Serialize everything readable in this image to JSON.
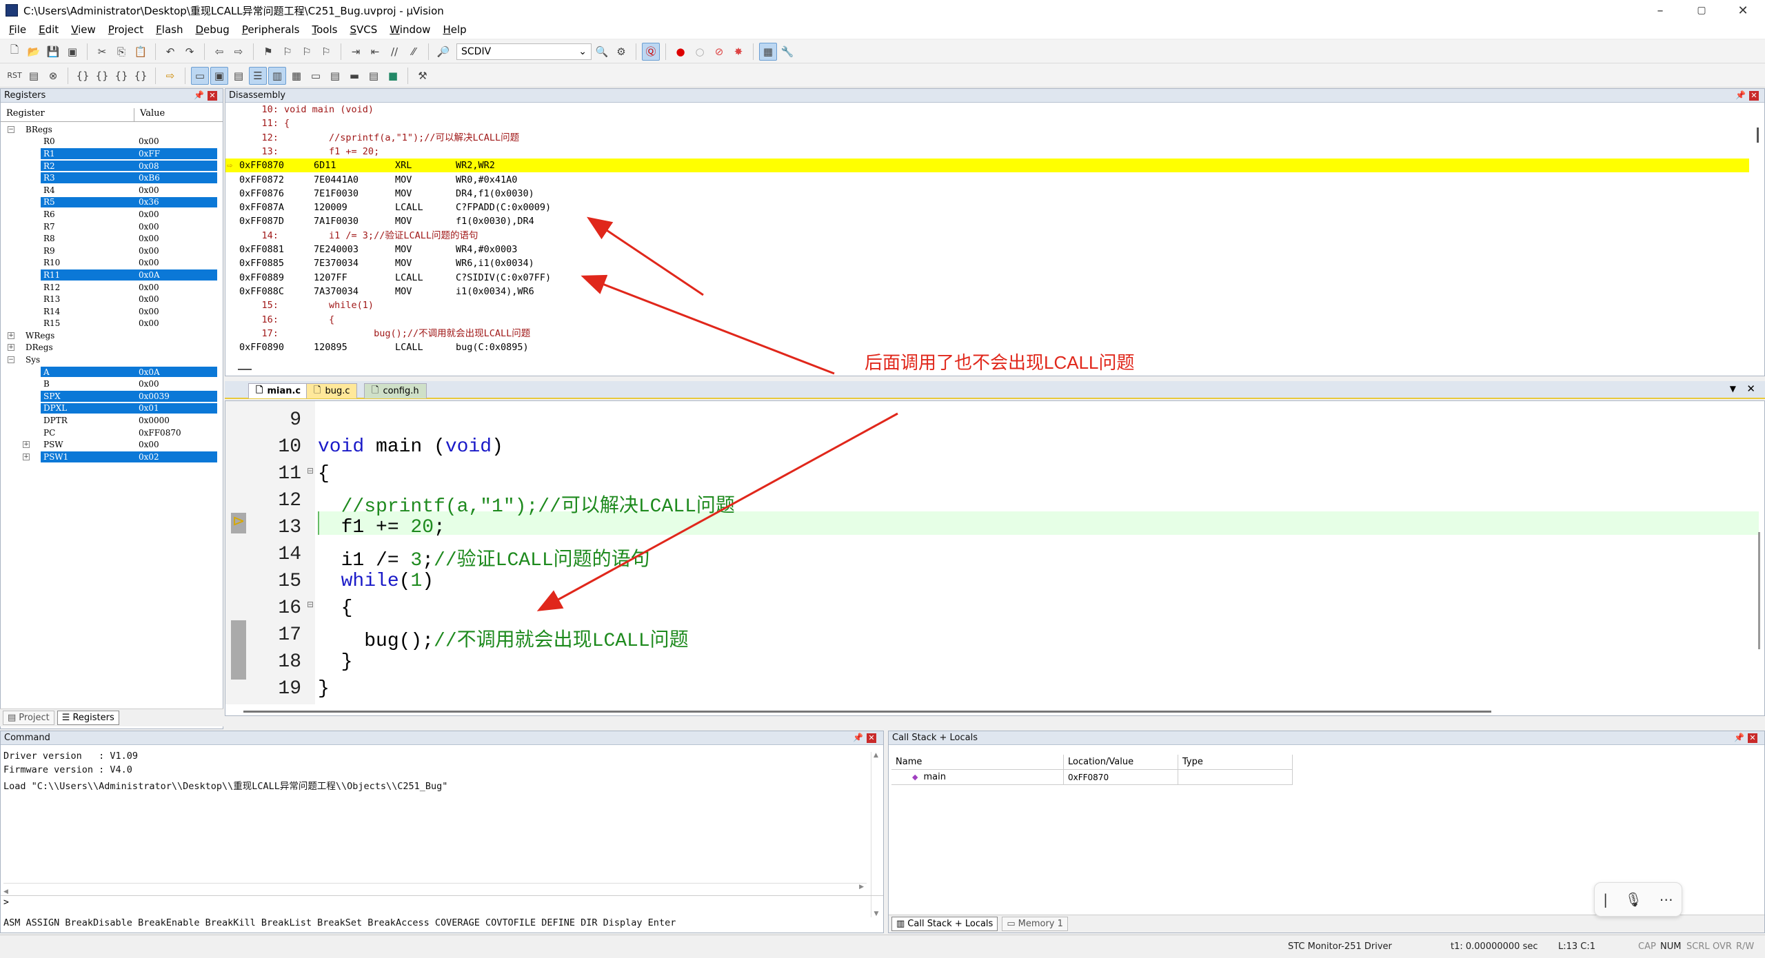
{
  "window": {
    "title": "C:\\Users\\Administrator\\Desktop\\重现LCALL异常问题工程\\C251_Bug.uvproj - µVision",
    "minimize": "–",
    "maximize": "▢",
    "close": "✕"
  },
  "menu": [
    "File",
    "Edit",
    "View",
    "Project",
    "Flash",
    "Debug",
    "Peripherals",
    "Tools",
    "SVCS",
    "Window",
    "Help"
  ],
  "toolbar": {
    "target_select": "SCDIV"
  },
  "registers": {
    "title": "Registers",
    "col_register": "Register",
    "col_value": "Value",
    "rows": [
      {
        "name": "BRegs",
        "value": "",
        "group": true,
        "expanded": true,
        "sel": false
      },
      {
        "name": "R0",
        "value": "0x00",
        "sel": false
      },
      {
        "name": "R1",
        "value": "0xFF",
        "sel": true
      },
      {
        "name": "R2",
        "value": "0x08",
        "sel": true
      },
      {
        "name": "R3",
        "value": "0xB6",
        "sel": true
      },
      {
        "name": "R4",
        "value": "0x00",
        "sel": false
      },
      {
        "name": "R5",
        "value": "0x36",
        "sel": true
      },
      {
        "name": "R6",
        "value": "0x00",
        "sel": false
      },
      {
        "name": "R7",
        "value": "0x00",
        "sel": false
      },
      {
        "name": "R8",
        "value": "0x00",
        "sel": false
      },
      {
        "name": "R9",
        "value": "0x00",
        "sel": false
      },
      {
        "name": "R10",
        "value": "0x00",
        "sel": false
      },
      {
        "name": "R11",
        "value": "0x0A",
        "sel": true
      },
      {
        "name": "R12",
        "value": "0x00",
        "sel": false
      },
      {
        "name": "R13",
        "value": "0x00",
        "sel": false
      },
      {
        "name": "R14",
        "value": "0x00",
        "sel": false
      },
      {
        "name": "R15",
        "value": "0x00",
        "sel": false
      },
      {
        "name": "WRegs",
        "value": "",
        "group": true,
        "expanded": false,
        "sel": false
      },
      {
        "name": "DRegs",
        "value": "",
        "group": true,
        "expanded": false,
        "sel": false
      },
      {
        "name": "Sys",
        "value": "",
        "group": true,
        "expanded": true,
        "sel": false
      },
      {
        "name": "A",
        "value": "0x0A",
        "sel": true
      },
      {
        "name": "B",
        "value": "0x00",
        "sel": false
      },
      {
        "name": "SPX",
        "value": "0x0039",
        "sel": true
      },
      {
        "name": "DPXL",
        "value": "0x01",
        "sel": true
      },
      {
        "name": "DPTR",
        "value": "0x0000",
        "sel": false
      },
      {
        "name": "PC",
        "value": "0xFF0870",
        "sel": false
      },
      {
        "name": "PSW",
        "value": "0x00",
        "sel": false,
        "sub": true
      },
      {
        "name": "PSW1",
        "value": "0x02",
        "sel": true,
        "sub": true
      }
    ],
    "tab_project": "Project",
    "tab_registers": "Registers"
  },
  "disassembly": {
    "title": "Disassembly",
    "lines": [
      {
        "kind": "src",
        "text": "    10: void main (void)"
      },
      {
        "kind": "src",
        "text": "    11: {"
      },
      {
        "kind": "src",
        "text": "    12:         //sprintf(a,\"1\");//可以解决LCALL问题"
      },
      {
        "kind": "src",
        "text": "    13:         f1 += 20;"
      },
      {
        "kind": "cur",
        "addr": "0xFF0870",
        "op": "6D11",
        "mn": "XRL",
        "arg": "WR2,WR2"
      },
      {
        "kind": "asm",
        "addr": "0xFF0872",
        "op": "7E0441A0",
        "mn": "MOV",
        "arg": "WR0,#0x41A0"
      },
      {
        "kind": "asm",
        "addr": "0xFF0876",
        "op": "7E1F0030",
        "mn": "MOV",
        "arg": "DR4,f1(0x0030)"
      },
      {
        "kind": "asm",
        "addr": "0xFF087A",
        "op": "120009",
        "mn": "LCALL",
        "arg": "C?FPADD(C:0x0009)"
      },
      {
        "kind": "asm",
        "addr": "0xFF087D",
        "op": "7A1F0030",
        "mn": "MOV",
        "arg": "f1(0x0030),DR4"
      },
      {
        "kind": "src",
        "text": "    14:         i1 /= 3;//验证LCALL问题的语句"
      },
      {
        "kind": "asm",
        "addr": "0xFF0881",
        "op": "7E240003",
        "mn": "MOV",
        "arg": "WR4,#0x0003"
      },
      {
        "kind": "asm",
        "addr": "0xFF0885",
        "op": "7E370034",
        "mn": "MOV",
        "arg": "WR6,i1(0x0034)"
      },
      {
        "kind": "asm",
        "addr": "0xFF0889",
        "op": "1207FF",
        "mn": "LCALL",
        "arg": "C?SIDIV(C:0x07FF)"
      },
      {
        "kind": "asm",
        "addr": "0xFF088C",
        "op": "7A370034",
        "mn": "MOV",
        "arg": "i1(0x0034),WR6"
      },
      {
        "kind": "src",
        "text": "    15:         while(1)"
      },
      {
        "kind": "src",
        "text": "    16:         {"
      },
      {
        "kind": "src",
        "text": "    17:                 bug();//不调用就会出现LCALL问题"
      },
      {
        "kind": "asm",
        "addr": "0xFF0890",
        "op": "120895",
        "mn": "LCALL",
        "arg": "bug(C:0x0895)"
      }
    ]
  },
  "editor": {
    "tabs": [
      "mian.c",
      "bug.c",
      "config.h"
    ],
    "lines": [
      {
        "n": "9"
      },
      {
        "n": "10"
      },
      {
        "n": "11"
      },
      {
        "n": "12"
      },
      {
        "n": "13"
      },
      {
        "n": "14"
      },
      {
        "n": "15"
      },
      {
        "n": "16"
      },
      {
        "n": "17"
      },
      {
        "n": "18"
      },
      {
        "n": "19"
      }
    ],
    "code": {
      "l10_kw1": "void",
      "l10_mid": " main (",
      "l10_kw2": "void",
      "l10_end": ")",
      "l11": "{",
      "l12": "  //sprintf(a,\"1\");//可以解决LCALL问题",
      "l13_a": "  f1 += ",
      "l13_n": "20",
      "l13_b": ";",
      "l14_a": "  i1 /= ",
      "l14_n": "3",
      "l14_b": ";",
      "l14_c": "//验证LCALL问题的语句",
      "l15_kw": "  while",
      "l15_a": "(",
      "l15_n": "1",
      "l15_b": ")",
      "l16": "  {",
      "l17_a": "    bug();",
      "l17_c": "//不调用就会出现LCALL问题",
      "l18": "  }",
      "l19": "}"
    }
  },
  "annotation": "后面调用了也不会出现LCALL问题",
  "command": {
    "title": "Command",
    "lines": [
      "Driver version   : V1.09",
      "Firmware version : V4.0",
      "Load \"C:\\\\Users\\\\Administrator\\\\Desktop\\\\重现LCALL异常问题工程\\\\Objects\\\\C251_Bug\""
    ],
    "prompt": ">",
    "help": "ASM ASSIGN BreakDisable BreakEnable BreakKill BreakList BreakSet BreakAccess COVERAGE COVTOFILE DEFINE DIR Display Enter"
  },
  "callstack": {
    "title": "Call Stack + Locals",
    "col_name": "Name",
    "col_loc": "Location/Value",
    "col_type": "Type",
    "row_name": "main",
    "row_loc": "0xFF0870",
    "row_type": "",
    "tab_callstack": "Call Stack + Locals",
    "tab_memory": "Memory 1"
  },
  "status": {
    "driver": "STC Monitor-251 Driver",
    "time": "t1: 0.00000000 sec",
    "pos": "L:13 C:1",
    "cap": "CAP",
    "num": "NUM",
    "scrl": "SCRL",
    "ovr": "OVR",
    "rw": "R/W"
  },
  "colors": {
    "current_line": "#ffff00",
    "selection": "#0b78d7",
    "annotation": "#e0271b"
  }
}
